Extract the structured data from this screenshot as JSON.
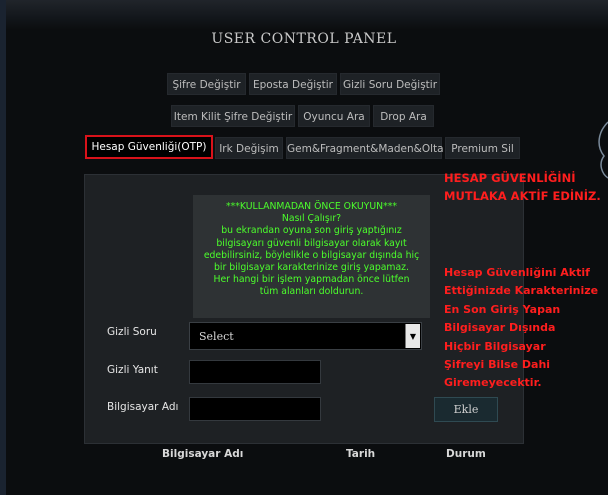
{
  "title": "USER CONTROL PANEL",
  "tabs_row1": [
    "Şifre Değiştir",
    "Eposta Değiştir",
    "Gizli Soru Değiştir"
  ],
  "tabs_row2": [
    "Item Kilit Şifre Değiştir",
    "Oyuncu Ara",
    "Drop Ara"
  ],
  "tabs_row3": [
    "Hesap Güvenliği(OTP)",
    "Irk Değişim",
    "Gem&Fragment&Maden&Olta",
    "Premium Sil"
  ],
  "notice": {
    "line1": "***KULLANMADAN ÖNCE OKUYUN***",
    "line2": "Nasıl Çalışır?",
    "line3": "bu ekrandan oyuna son giriş yaptığınız",
    "line4": "bilgisayarı güvenli bilgisayar olarak kayıt",
    "line5": "edebilirsiniz, böylelikle o bilgisayar dışında hiç",
    "line6": "bir bilgisayar karakterinize giriş yapamaz.",
    "line7": "Her hangi bir işlem yapmadan önce lütfen",
    "line8": "tüm alanları doldurun."
  },
  "form": {
    "secret_question_label": "Gizli Soru",
    "secret_question_value": "Select",
    "secret_answer_label": "Gizli Yanıt",
    "computer_name_label": "Bilgisayar Adı",
    "add_button": "Ekle"
  },
  "table_headers": [
    "Bilgisayar Adı",
    "Tarih",
    "Durum"
  ],
  "warning_top": [
    "HESAP GÜVENLİĞİNİ",
    "MUTLAKA AKTİF EDİNİZ."
  ],
  "warning_bottom": [
    "Hesap Güvenliğini Aktif",
    "Ettiğinizde Karakterinize",
    "En Son Giriş Yapan",
    "Bilgisayar Dışında",
    "Hiçbir Bilgisayar",
    "Şifreyi Bilse Dahi",
    "Giremeyecektir."
  ],
  "colors": {
    "accent_red": "#d9121a",
    "notice_green": "#4cff2c",
    "warning_red": "#ff1e1e"
  }
}
